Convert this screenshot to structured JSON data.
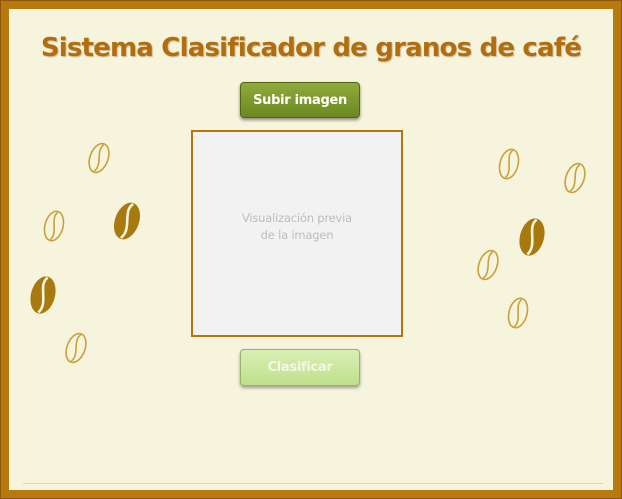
{
  "app": {
    "title": "Sistema Clasificador de granos de café"
  },
  "toolbar": {
    "upload_label": "Subir imagen",
    "classify_label": "Clasificar"
  },
  "preview": {
    "placeholder_line1": "Visualización previa",
    "placeholder_line2": "de la imagen"
  },
  "colors": {
    "frame": "#b8790f",
    "background": "#f6f4dd",
    "title": "#b26e0e",
    "upload_button": "#7a9530",
    "classify_button": "#cbe6a0",
    "bean_filled": "#a8790f",
    "bean_outline": "#c9a13a"
  },
  "decorations": {
    "icon": "coffee-bean-icon"
  }
}
